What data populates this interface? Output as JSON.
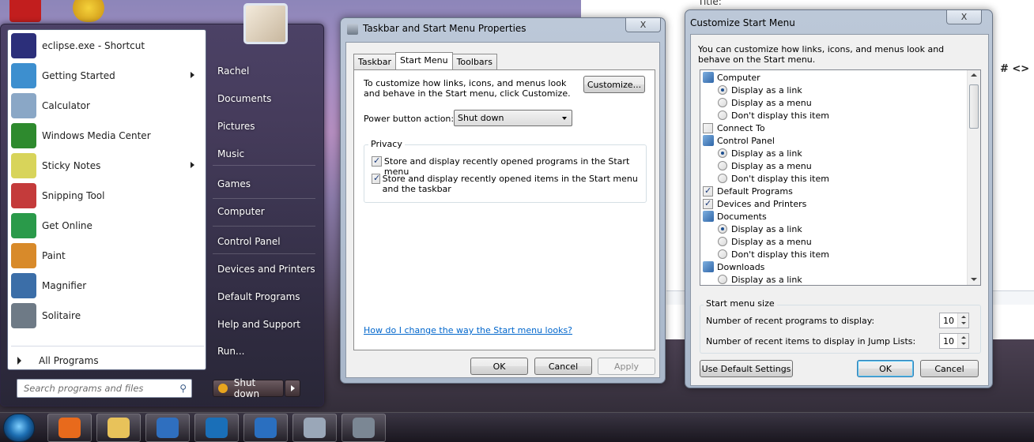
{
  "start_menu": {
    "programs": [
      {
        "label": "eclipse.exe - Shortcut",
        "icon": "eclipse-icon",
        "color": "#2c2f7a",
        "arrow": false
      },
      {
        "label": "Getting Started",
        "icon": "getting-started-icon",
        "color": "#3d8fcf",
        "arrow": true
      },
      {
        "label": "Calculator",
        "icon": "calculator-icon",
        "color": "#8aa7c6",
        "arrow": false
      },
      {
        "label": "Windows Media Center",
        "icon": "media-center-icon",
        "color": "#2e8a2e",
        "arrow": false
      },
      {
        "label": "Sticky Notes",
        "icon": "sticky-notes-icon",
        "color": "#d8d45a",
        "arrow": true
      },
      {
        "label": "Snipping Tool",
        "icon": "snipping-tool-icon",
        "color": "#c43b3b",
        "arrow": false
      },
      {
        "label": "Get Online",
        "icon": "get-online-icon",
        "color": "#2a9a4a",
        "arrow": false
      },
      {
        "label": "Paint",
        "icon": "paint-icon",
        "color": "#d88a2a",
        "arrow": false
      },
      {
        "label": "Magnifier",
        "icon": "magnifier-icon",
        "color": "#3b6ea8",
        "arrow": false
      },
      {
        "label": "Solitaire",
        "icon": "solitaire-icon",
        "color": "#6e7a86",
        "arrow": false
      }
    ],
    "all_programs": "All Programs",
    "search_placeholder": "Search programs and files",
    "right_items": [
      "Rachel",
      "Documents",
      "Pictures",
      "Music",
      "Games",
      "Computer",
      "Control Panel",
      "Devices and Printers",
      "Default Programs",
      "Help and Support",
      "Run..."
    ],
    "shutdown_label": "Shut down"
  },
  "taskbar_props": {
    "title": "Taskbar and Start Menu Properties",
    "close": "X",
    "tabs": [
      "Taskbar",
      "Start Menu",
      "Toolbars"
    ],
    "description": "To customize how links, icons, and menus look and behave in the Start menu, click Customize.",
    "customize_btn": "Customize...",
    "power_label": "Power button action:",
    "power_value": "Shut down",
    "privacy_label": "Privacy",
    "privacy_opt1": "Store and display recently opened programs in the Start menu",
    "privacy_opt2": "Store and display recently opened items in the Start menu and the taskbar",
    "help_link": "How do I change the way the Start menu looks?",
    "ok": "OK",
    "cancel": "Cancel",
    "apply": "Apply"
  },
  "customize": {
    "title": "Customize Start Menu",
    "close": "X",
    "description": "You can customize how links, icons, and menus look and behave on the Start menu.",
    "list": [
      {
        "kind": "header",
        "label": "Computer",
        "icon": "computer-icon"
      },
      {
        "kind": "radio",
        "label": "Display as a link",
        "on": true
      },
      {
        "kind": "radio",
        "label": "Display as a menu",
        "on": false
      },
      {
        "kind": "radio",
        "label": "Don't display this item",
        "on": false
      },
      {
        "kind": "check",
        "label": "Connect To",
        "on": false
      },
      {
        "kind": "header",
        "label": "Control Panel",
        "icon": "control-panel-icon"
      },
      {
        "kind": "radio",
        "label": "Display as a link",
        "on": true
      },
      {
        "kind": "radio",
        "label": "Display as a menu",
        "on": false
      },
      {
        "kind": "radio",
        "label": "Don't display this item",
        "on": false
      },
      {
        "kind": "check",
        "label": "Default Programs",
        "on": true
      },
      {
        "kind": "check",
        "label": "Devices and Printers",
        "on": true
      },
      {
        "kind": "header",
        "label": "Documents",
        "icon": "documents-icon"
      },
      {
        "kind": "radio",
        "label": "Display as a link",
        "on": true
      },
      {
        "kind": "radio",
        "label": "Display as a menu",
        "on": false
      },
      {
        "kind": "radio",
        "label": "Don't display this item",
        "on": false
      },
      {
        "kind": "header",
        "label": "Downloads",
        "icon": "downloads-icon"
      },
      {
        "kind": "radio",
        "label": "Display as a link",
        "on": false
      }
    ],
    "size_label": "Start menu size",
    "recent_programs_label": "Number of recent programs to display:",
    "recent_programs_value": "10",
    "jump_list_label": "Number of recent items to display in Jump Lists:",
    "jump_list_value": "10",
    "defaults_btn": "Use Default Settings",
    "ok": "OK",
    "cancel": "Cancel"
  },
  "editor_bg": {
    "text1": "Title:",
    "symbols": "# <>"
  },
  "taskbar": {
    "buttons": [
      {
        "icon": "firefox-icon",
        "color": "#e86a1c"
      },
      {
        "icon": "explorer-icon",
        "color": "#e8c25a"
      },
      {
        "icon": "media-player-icon",
        "color": "#2f6fbf"
      },
      {
        "icon": "hp-icon",
        "color": "#1a6fb8"
      },
      {
        "icon": "chart-app-icon",
        "color": "#2a6fc0"
      },
      {
        "icon": "document-app-icon",
        "color": "#9aa7b8"
      },
      {
        "icon": "control-panel-app-icon",
        "color": "#7b8794"
      }
    ]
  }
}
